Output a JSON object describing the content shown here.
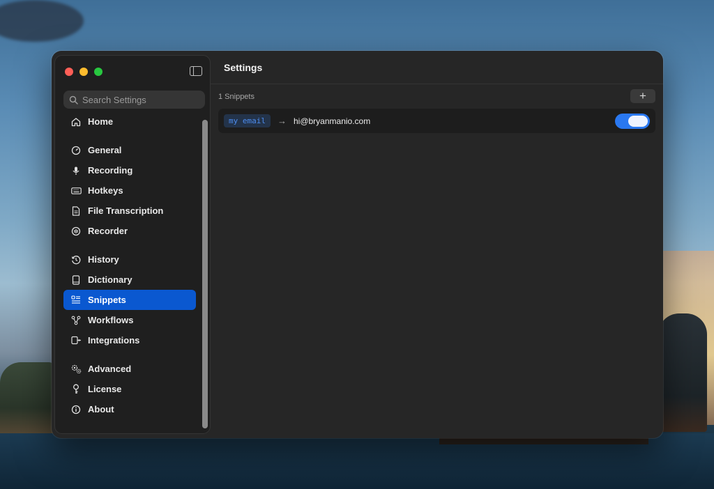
{
  "sidebar": {
    "search_placeholder": "Search Settings",
    "items": [
      {
        "label": "Home",
        "icon": "house-icon"
      },
      {
        "label": "General",
        "icon": "gauge-icon"
      },
      {
        "label": "Recording",
        "icon": "microphone-icon"
      },
      {
        "label": "Hotkeys",
        "icon": "keyboard-icon"
      },
      {
        "label": "File Transcription",
        "icon": "document-icon"
      },
      {
        "label": "Recorder",
        "icon": "record-icon"
      },
      {
        "label": "History",
        "icon": "history-icon"
      },
      {
        "label": "Dictionary",
        "icon": "book-icon"
      },
      {
        "label": "Snippets",
        "icon": "snippets-icon",
        "active": true
      },
      {
        "label": "Workflows",
        "icon": "workflow-icon"
      },
      {
        "label": "Integrations",
        "icon": "integrations-icon"
      },
      {
        "label": "Advanced",
        "icon": "gears-icon"
      },
      {
        "label": "License",
        "icon": "key-icon"
      },
      {
        "label": "About",
        "icon": "info-icon"
      }
    ]
  },
  "main": {
    "title": "Settings",
    "count_label": "1 Snippets",
    "add_label": "+",
    "snippets": [
      {
        "trigger": "my email",
        "arrow": "→",
        "expansion": "hi@bryanmanio.com",
        "enabled": true
      }
    ]
  },
  "colors": {
    "accent": "#0a58d0",
    "toggle_on": "#2a78f0",
    "trigger_text": "#4d8df0"
  }
}
